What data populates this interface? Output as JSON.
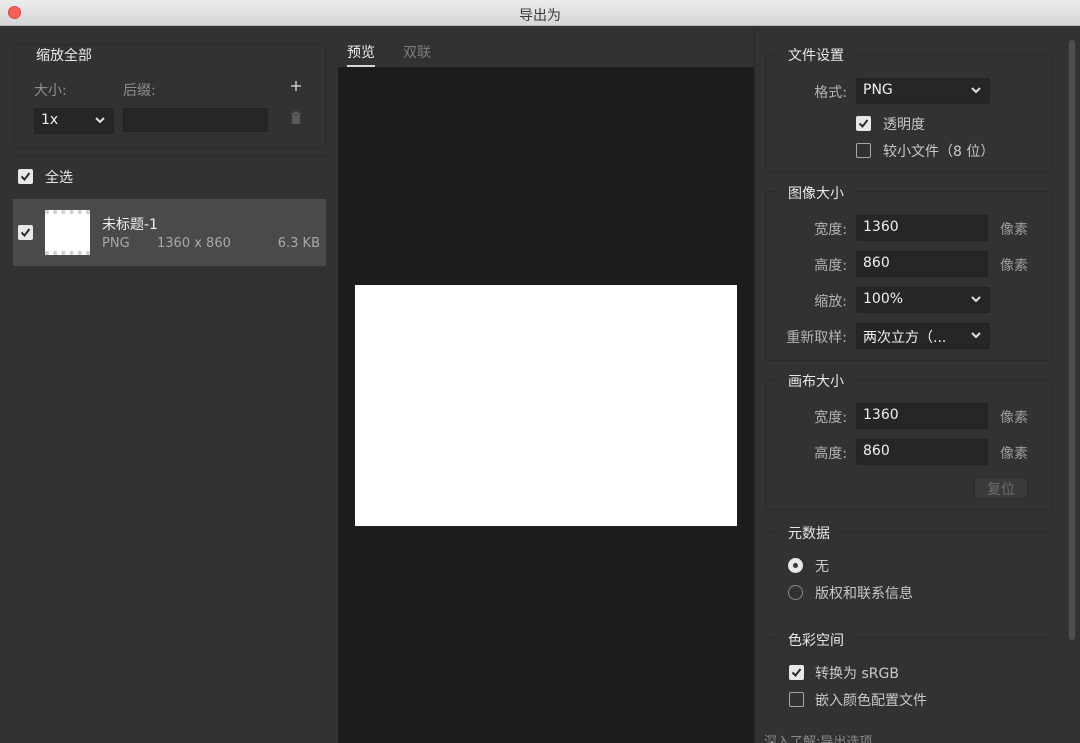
{
  "window": {
    "title": "导出为"
  },
  "left": {
    "scale_group_title": "缩放全部",
    "size_label": "大小:",
    "suffix_label": "后缀:",
    "add_icon": "plus-icon",
    "delete_icon": "trash-icon",
    "scale_select_value": "1x",
    "suffix_value": "",
    "select_all_label": "全选",
    "select_all_checked": true,
    "items": [
      {
        "name": "未标题-1",
        "format": "PNG",
        "dimensions": "1360 x 860",
        "size": "6.3 KB",
        "checked": true
      }
    ]
  },
  "center": {
    "tabs": [
      {
        "label": "预览",
        "active": true
      },
      {
        "label": "双联",
        "active": false
      }
    ]
  },
  "right": {
    "file_settings": {
      "title": "文件设置",
      "format_label": "格式:",
      "format_value": "PNG",
      "transparency_label": "透明度",
      "transparency_checked": true,
      "smaller_file_label": "较小文件（8 位）",
      "smaller_file_checked": false
    },
    "image_size": {
      "title": "图像大小",
      "width_label": "宽度:",
      "width_value": "1360",
      "height_label": "高度:",
      "height_value": "860",
      "unit": "像素",
      "scale_label": "缩放:",
      "scale_value": "100%",
      "resample_label": "重新取样:",
      "resample_value": "两次立方（..."
    },
    "canvas_size": {
      "title": "画布大小",
      "width_label": "宽度:",
      "width_value": "1360",
      "height_label": "高度:",
      "height_value": "860",
      "unit": "像素",
      "reset_label": "复位"
    },
    "metadata": {
      "title": "元数据",
      "option_none": "无",
      "option_copyright": "版权和联系信息",
      "selected": "none"
    },
    "color_space": {
      "title": "色彩空间",
      "convert_srgb_label": "转换为 sRGB",
      "convert_srgb_checked": true,
      "embed_profile_label": "嵌入颜色配置文件",
      "embed_profile_checked": false
    },
    "footer_partial": "深入了解:导出选项"
  },
  "colors": {
    "window_bg": "#323232",
    "preview_bg": "#1c1c1c",
    "selected_row": "#4a4a4a",
    "close_button": "#fd5f57"
  }
}
